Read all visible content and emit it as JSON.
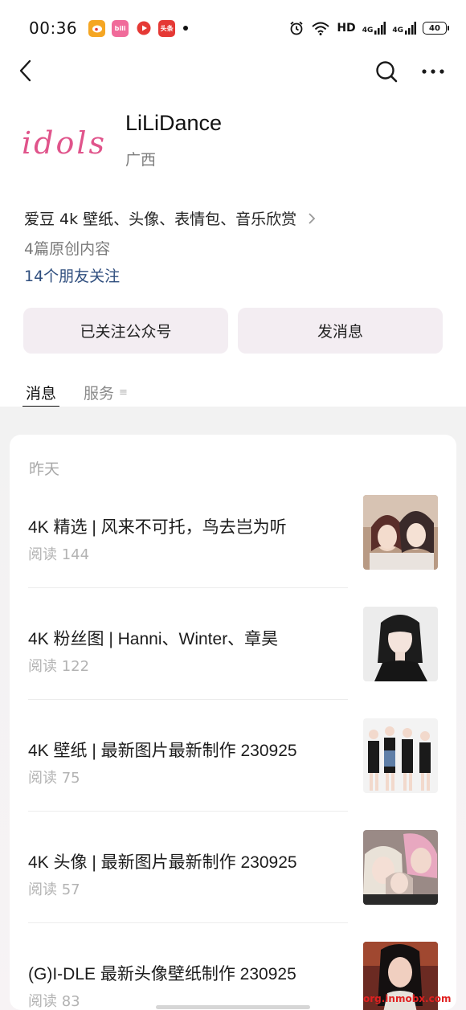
{
  "status_bar": {
    "time": "00:36",
    "apps": [
      {
        "name": "weibo-icon",
        "color": "#f5a623",
        "label": ""
      },
      {
        "name": "bilibili-icon",
        "color": "#f06b9a",
        "label": "bili"
      },
      {
        "name": "video-app-icon",
        "color": "#e53935",
        "label": ""
      },
      {
        "name": "toutiao-icon",
        "color": "#e53935",
        "label": "头条"
      }
    ],
    "hd_label": "HD",
    "network_1": "4G",
    "network_2": "4G",
    "battery": "40"
  },
  "nav": {
    "back_icon": "back-arrow-icon",
    "search_icon": "search-icon",
    "more_icon": "more-icon"
  },
  "profile": {
    "avatar_text": "idols",
    "account_name": "LiLiDance",
    "region": "广西"
  },
  "intro": {
    "description": "爱豆 4k 壁纸、头像、表情包、音乐欣赏",
    "original_count": "4篇原创内容",
    "friends_follow": "14个朋友关注"
  },
  "actions": {
    "followed": "已关注公众号",
    "send_message": "发消息"
  },
  "tabs": [
    {
      "label": "消息",
      "active": true
    },
    {
      "label": "服务",
      "active": false
    }
  ],
  "tab_menu_glyph": "≡",
  "feed": {
    "date_label": "昨天",
    "articles": [
      {
        "title": "4K 精选 | 风来不可托，鸟去岂为听",
        "reads": "阅读 144"
      },
      {
        "title": "4K 粉丝图 | Hanni、Winter、章昊",
        "reads": "阅读 122"
      },
      {
        "title": "4K 壁纸 | 最新图片最新制作 230925",
        "reads": "阅读 75"
      },
      {
        "title": "4K 头像 | 最新图片最新制作 230925",
        "reads": "阅读 57"
      },
      {
        "title": "(G)I-DLE 最新头像壁纸制作 230925",
        "reads": "阅读 83"
      }
    ]
  },
  "watermark": "org.inmobx.com",
  "colors": {
    "accent_link": "#2f4e7e",
    "button_bg": "#f3edf2",
    "avatar_pink": "#e0548b"
  }
}
